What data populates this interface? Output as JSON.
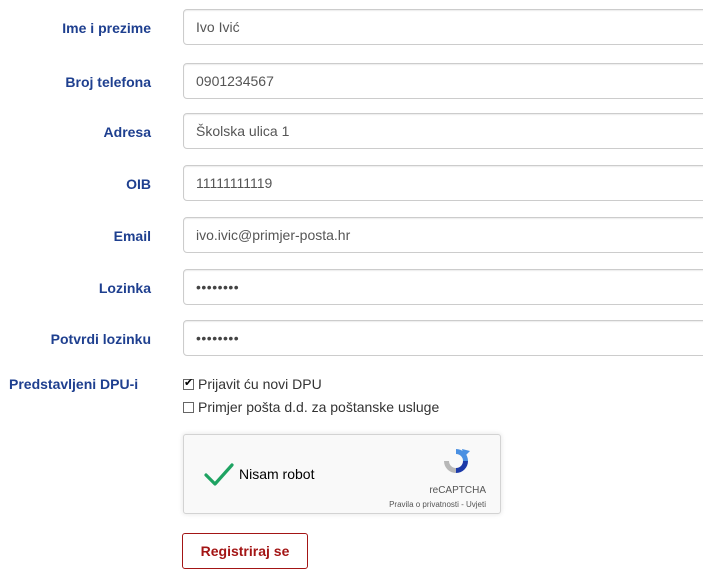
{
  "form": {
    "fields": [
      {
        "label": "Ime i prezime",
        "value": "Ivo Ivić"
      },
      {
        "label": "Broj telefona",
        "value": "0901234567"
      },
      {
        "label": "Adresa",
        "value": "Školska ulica 1"
      },
      {
        "label": "OIB",
        "value": "11111111119"
      },
      {
        "label": "Email",
        "value": "ivo.ivic@primjer-posta.hr"
      },
      {
        "label": "Lozinka",
        "value": "••••••••"
      },
      {
        "label": "Potvrdi lozinku",
        "value": "••••••••"
      }
    ],
    "dpu": {
      "label": "Predstavljeni DPU-i",
      "options": [
        {
          "label": "Prijavit ću novi DPU",
          "checked": true
        },
        {
          "label": "Primjer pošta d.d. za poštanske usluge",
          "checked": false
        }
      ]
    },
    "captcha": {
      "text": "Nisam robot",
      "brand": "reCAPTCHA",
      "terms": "Pravila o privatnosti - Uvjeti",
      "check_color": "#1ea362"
    },
    "submit_label": "Registriraj se"
  },
  "colors": {
    "label": "#1e3f8f",
    "accent": "#a31515"
  }
}
